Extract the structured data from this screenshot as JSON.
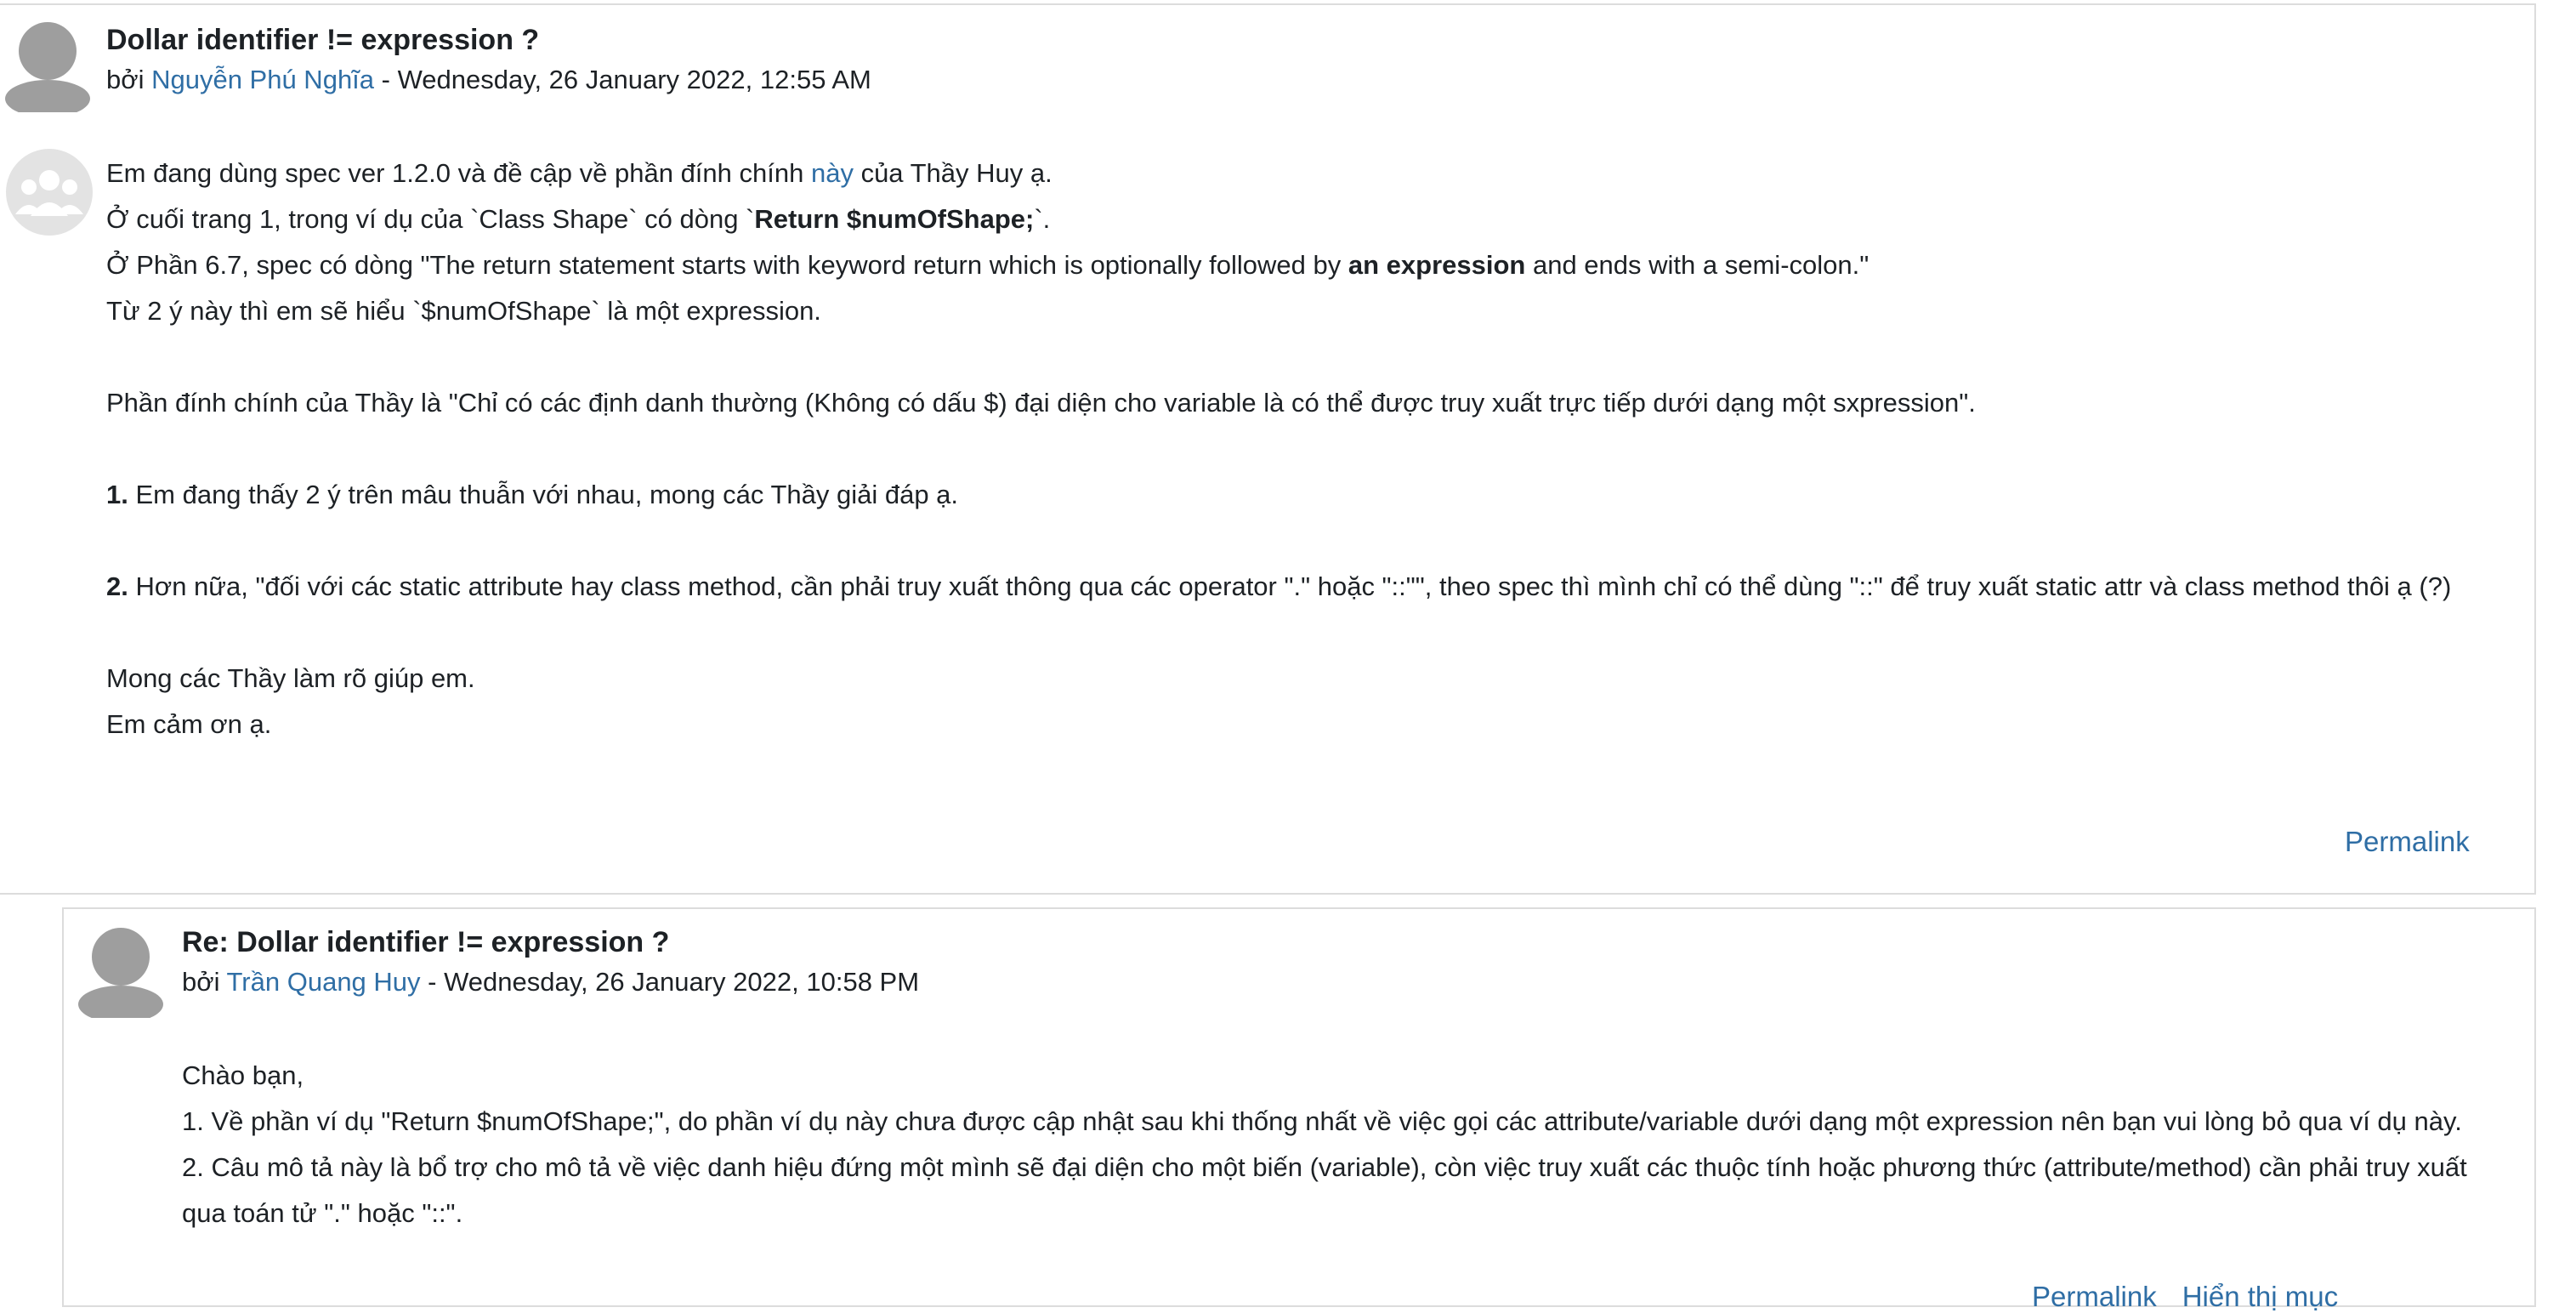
{
  "post1": {
    "subject": "Dollar identifier != expression ?",
    "by_prefix": "bởi ",
    "author": "Nguyễn Phú Nghĩa",
    "date_sep": " - ",
    "date": "Wednesday, 26 January 2022, 12:55 AM",
    "line1_a": "Em đang dùng spec ver 1.2.0 và đề cập về phần đính chính ",
    "line1_link": "này",
    "line1_b": " của Thầy Huy ạ.",
    "line2_a": "Ở cuối trang 1, trong ví dụ của `Class Shape` có dòng `",
    "line2_bold": "Return $numOfShape;",
    "line2_b": "`.",
    "line3_a": "Ở Phần 6.7, spec có dòng \"The return statement starts with keyword return which is optionally followed by ",
    "line3_bold": "an expression",
    "line3_b": " and ends with a semi-colon.\"",
    "line4": "Từ 2 ý này thì em sẽ hiểu `$numOfShape` là một expression.",
    "line5": "Phần đính chính của Thầy là \"Chỉ có các định danh thường (Không có dấu $) đại diện cho variable là có thể được truy xuất trực tiếp dưới dạng một sxpression\".",
    "item1_num": "1.",
    "item1_text": " Em đang thấy 2 ý trên mâu thuẫn với nhau, mong các Thầy giải đáp ạ.",
    "item2_num": "2.",
    "item2_text": " Hơn nữa, \"đối với các static attribute hay class method, cần phải truy xuất thông qua các operator \".\" hoặc \"::\"\", theo spec thì mình chỉ có thể dùng \"::\" để truy xuất static attr và class method thôi ạ (?)",
    "closing1": "Mong các Thầy làm rõ giúp em.",
    "closing2": "Em cảm ơn ạ.",
    "permalink": "Permalink"
  },
  "post2": {
    "subject": "Re: Dollar identifier != expression ?",
    "by_prefix": "bởi ",
    "author": "Trần Quang Huy",
    "date_sep": " - ",
    "date": "Wednesday, 26 January 2022, 10:58 PM",
    "line1": "Chào bạn,",
    "line2": "1. Về phần ví dụ \"Return $numOfShape;\", do phần ví dụ này chưa được cập nhật sau khi thống nhất về việc gọi các attribute/variable dưới dạng một expression nên bạn vui lòng bỏ qua ví dụ này.",
    "line3": "2. Câu mô tả này là bổ trợ cho mô tả về việc danh hiệu đứng một mình sẽ đại diện cho một biến (variable), còn việc truy xuất các thuộc tính hoặc phương thức (attribute/method) cần phải truy xuất",
    "line4": "qua toán tử \".\" hoặc \"::\".",
    "link_permalink": "Permalink",
    "link_parent": "Hiển thị mục"
  }
}
